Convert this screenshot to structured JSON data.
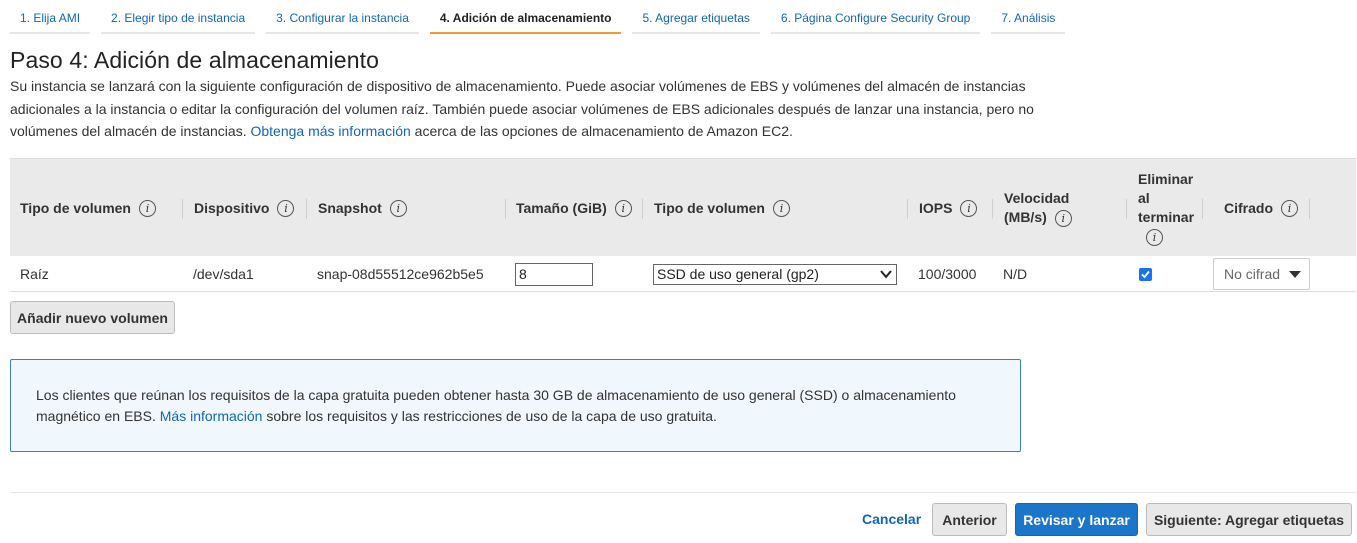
{
  "wizard": {
    "tabs": [
      {
        "label": "1. Elija AMI"
      },
      {
        "label": "2. Elegir tipo de instancia"
      },
      {
        "label": "3. Configurar la instancia"
      },
      {
        "label": "4. Adición de almacenamiento"
      },
      {
        "label": "5. Agregar etiquetas"
      },
      {
        "label": "6. Página Configure Security Group"
      },
      {
        "label": "7. Análisis"
      }
    ],
    "active_tab": "4. Adición de almacenamiento"
  },
  "page": {
    "title": "Paso 4: Adición de almacenamiento",
    "description_pre": "Su instancia se lanzará con la siguiente configuración de dispositivo de almacenamiento. Puede asociar volúmenes de EBS y volúmenes del almacén de instancias adicionales a la instancia o editar la configuración del volumen raíz. También puede asociar volúmenes de EBS adicionales después de lanzar una instancia, pero no volúmenes del almacén de instancias.",
    "description_link": "Obtenga más información",
    "description_post": "acerca de las opciones de almacenamiento de Amazon EC2."
  },
  "table": {
    "headers": {
      "volume_type": "Tipo de volumen",
      "device": "Dispositivo",
      "snapshot": "Snapshot",
      "size": "Tamaño (GiB)",
      "volume_type2": "Tipo de volumen",
      "iops": "IOPS",
      "throughput_1": "Velocidad",
      "throughput_2": "(MB/s)",
      "delete_1": "Eliminar",
      "delete_2": "al",
      "delete_3": "terminar",
      "encryption": "Cifrado"
    },
    "row": {
      "volume_type": "Raíz",
      "device": "/dev/sda1",
      "snapshot": "snap-08d55512ce962b5e5",
      "size": "8",
      "volume_type_select": "SSD de uso general (gp2)",
      "iops": "100/3000",
      "throughput": "N/D",
      "delete_on_termination": true,
      "encryption": "No cifrado"
    }
  },
  "add_volume_button": "Añadir nuevo volumen",
  "notice": {
    "text_pre": "Los clientes que reúnan los requisitos de la capa gratuita pueden obtener hasta 30 GB de almacenamiento de uso general (SSD) o almacenamiento magnético en EBS.",
    "link": "Más información",
    "text_post": "sobre los requisitos y las restricciones de uso de la capa de uso gratuita."
  },
  "footer": {
    "cancel": "Cancelar",
    "previous": "Anterior",
    "review_launch": "Revisar y lanzar",
    "next": "Siguiente: Agregar etiquetas"
  },
  "colors": {
    "accent_tab": "#f29a2e",
    "link": "#1166bb",
    "primary_button": "#1b75c8",
    "notice_border": "#3b7fc4",
    "notice_bg": "#f0f7fd"
  },
  "info_icon_glyph": "i"
}
